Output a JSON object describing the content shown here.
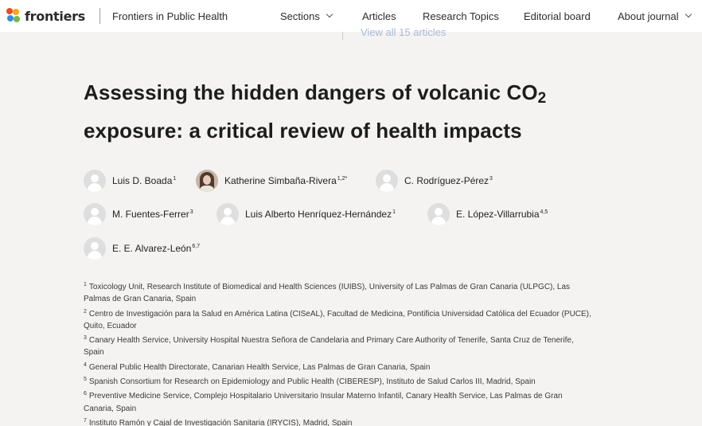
{
  "header": {
    "logo_text": "frontiers",
    "journal": "Frontiers in Public Health",
    "nav": [
      {
        "label": "Sections",
        "has_dropdown": true
      },
      {
        "label": "Articles",
        "has_dropdown": false
      },
      {
        "label": "Research Topics",
        "has_dropdown": false
      },
      {
        "label": "Editorial board",
        "has_dropdown": false
      },
      {
        "label": "About journal",
        "has_dropdown": true
      }
    ],
    "view_all": "View all 15 articles"
  },
  "article": {
    "title_line1": "Assessing the hidden dangers of volcanic CO",
    "title_sub": "2",
    "title_line2": "exposure: a critical review of health impacts"
  },
  "authors": [
    {
      "name": "Luis D. Boada",
      "sup": "1",
      "avatar": "placeholder"
    },
    {
      "name": "Katherine Simbaña-Rivera",
      "sup": "1,2*",
      "avatar": "photo"
    },
    {
      "name": "C. Rodríguez-Pérez",
      "sup": "3",
      "avatar": "placeholder"
    },
    {
      "name": "M. Fuentes-Ferrer",
      "sup": "3",
      "avatar": "placeholder"
    },
    {
      "name": "Luis Alberto Henríquez-Hernández",
      "sup": "1",
      "avatar": "placeholder"
    },
    {
      "name": "E. López-Villarrubia",
      "sup": "4,5",
      "avatar": "placeholder"
    },
    {
      "name": "E. E. Alvarez-León",
      "sup": "6,7",
      "avatar": "placeholder"
    }
  ],
  "affiliations": [
    {
      "num": "1",
      "text": "Toxicology Unit, Research Institute of Biomedical and Health Sciences (IUIBS), University of Las Palmas de Gran Canaria (ULPGC), Las Palmas de Gran Canaria, Spain"
    },
    {
      "num": "2",
      "text": "Centro de Investigación para la Salud en América Latina (CISeAL), Facultad de Medicina, Pontificia Universidad Católica del Ecuador (PUCE), Quito, Ecuador"
    },
    {
      "num": "3",
      "text": "Canary Health Service, University Hospital Nuestra Señora de Candelaria and Primary Care Authority of Tenerife, Santa Cruz de Tenerife, Spain"
    },
    {
      "num": "4",
      "text": "General Public Health Directorate, Canarian Health Service, Las Palmas de Gran Canaria, Spain"
    },
    {
      "num": "5",
      "text": "Spanish Consortium for Research on Epidemiology and Public Health (CIBERESP), Instituto de Salud Carlos III, Madrid, Spain"
    },
    {
      "num": "6",
      "text": "Preventive Medicine Service, Complejo Hospitalario Universitario Insular Materno Infantil, Canary Health Service, Las Palmas de Gran Canaria, Spain"
    },
    {
      "num": "7",
      "text": "Instituto Ramón y Cajal de Investigación Sanitaria (IRYCIS), Madrid, Spain"
    }
  ],
  "colors": {
    "logo_dots": [
      "#e94e1b",
      "#f5a623",
      "#2e8fd6",
      "#7ab648"
    ],
    "page_background": "#f4f3f1",
    "header_background": "#ffffff",
    "link_faded": "#a9b7d6"
  }
}
